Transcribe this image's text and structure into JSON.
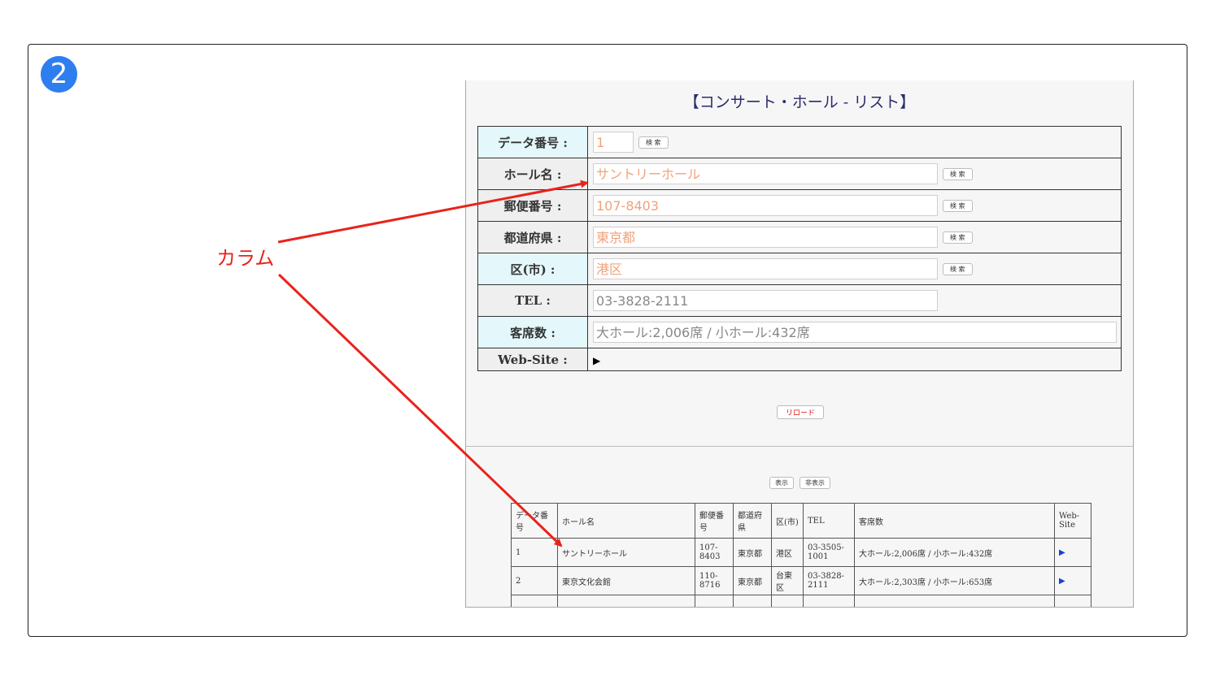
{
  "step_number": "2",
  "callout": {
    "label": "カラム",
    "color": "#e8231c"
  },
  "page": {
    "title": "【コンサート・ホール - リスト】",
    "form": {
      "rows": [
        {
          "label": "データ番号 :",
          "value": "1",
          "button": "検 索"
        },
        {
          "label": "ホール名 :",
          "value": "サントリーホール",
          "button": "検 索"
        },
        {
          "label": "郵便番号 :",
          "value": "107-8403",
          "button": "検 索"
        },
        {
          "label": "都道府県 :",
          "value": "東京都",
          "button": "検 索"
        },
        {
          "label": "区(市) :",
          "value": "港区",
          "button": "検 索"
        },
        {
          "label": "TEL :",
          "value": "03-3828-2111"
        },
        {
          "label": "客席数 :",
          "value": "大ホール:2,006席 / 小ホール:432席"
        },
        {
          "label": "Web-Site :",
          "icon": "play-icon"
        }
      ]
    },
    "reload_label": "リロード",
    "show_label": "表示",
    "hide_label": "非表示",
    "table": {
      "headers": [
        "データ番号",
        "ホール名",
        "郵便番号",
        "都道府県",
        "区(市)",
        "TEL",
        "客席数",
        "Web-Site"
      ],
      "rows": [
        [
          "1",
          "サントリーホール",
          "107-8403",
          "東京都",
          "港区",
          "03-3505-1001",
          "大ホール:2,006席 / 小ホール:432席"
        ],
        [
          "2",
          "東京文化会館",
          "110-8716",
          "東京都",
          "台東区",
          "03-3828-2111",
          "大ホール:2,303席 / 小ホール:653席"
        ]
      ]
    }
  },
  "colors": {
    "accent_blue": "#2f7ef0",
    "arrow_red": "#e8231c",
    "placeholder_orange": "#f0a27a",
    "label_cyan": "#e4f8fb"
  }
}
